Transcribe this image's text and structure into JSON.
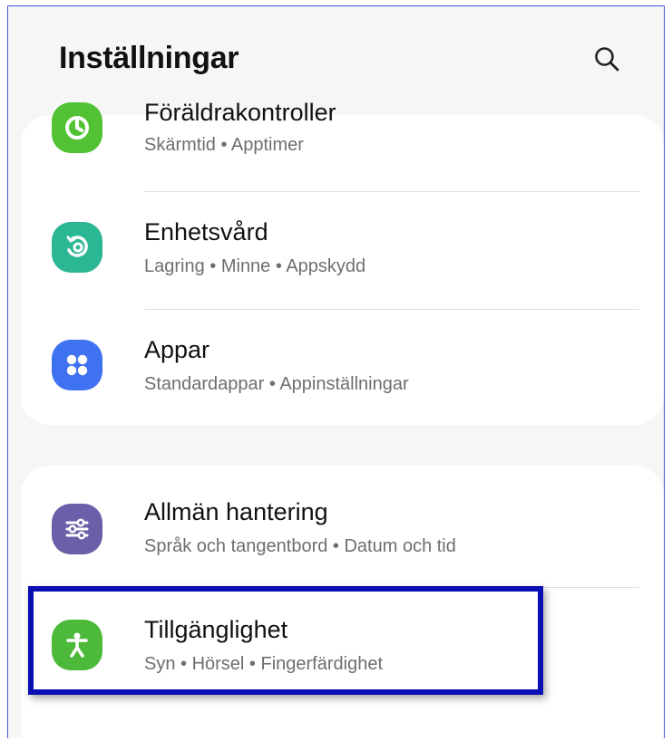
{
  "header": {
    "title": "Inställningar",
    "search_icon": "search-icon"
  },
  "group1": {
    "items": [
      {
        "label": "Föräldrakontroller",
        "sub_parts": [
          "Skärmtid",
          "Apptimer"
        ],
        "sub": "Skärmtid • Apptimer",
        "icon": "parental-controls-icon",
        "icon_color": "#52c234"
      },
      {
        "label": "Enhetsvård",
        "sub": "Lagring • Minne • Appskydd",
        "icon": "device-care-icon",
        "icon_color": "#2bb694"
      },
      {
        "label": "Appar",
        "sub": "Standardappar • Appinställningar",
        "icon": "apps-icon",
        "icon_color": "#3f72f0"
      }
    ]
  },
  "group2": {
    "items": [
      {
        "label": "Allmän hantering",
        "sub": "Språk och tangentbord • Datum och tid",
        "icon": "general-management-icon",
        "icon_color": "#6a5fa8"
      },
      {
        "label": "Tillgänglighet",
        "sub": "Syn • Hörsel • Fingerfärdighet",
        "icon": "accessibility-icon",
        "icon_color": "#4cb93a",
        "highlighted": true
      }
    ]
  },
  "colors": {
    "background": "#f6f6f6",
    "card": "#ffffff",
    "highlight_border": "#0a0fb4"
  }
}
